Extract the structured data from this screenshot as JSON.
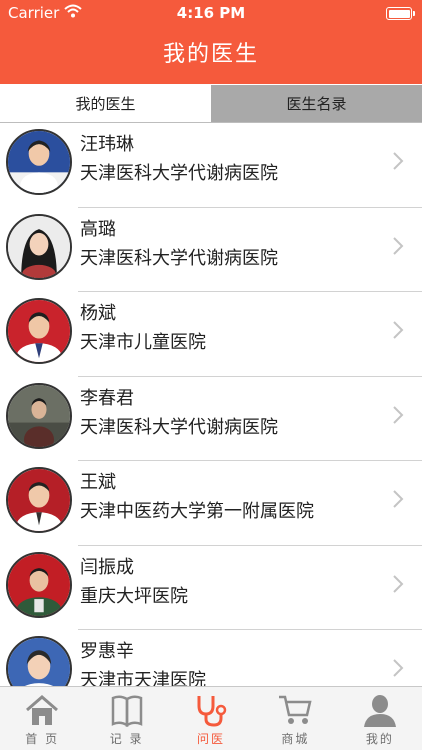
{
  "status_bar": {
    "carrier": "Carrier",
    "time": "4:16 PM",
    "wifi_icon": "wifi-icon",
    "battery_icon": "battery-icon"
  },
  "nav": {
    "title": "我的医生"
  },
  "segments": [
    {
      "label": "我的医生",
      "selected": true
    },
    {
      "label": "医生名录",
      "selected": false
    }
  ],
  "doctors": [
    {
      "name": "汪玮琳",
      "hospital": "天津医科大学代谢病医院"
    },
    {
      "name": "高璐",
      "hospital": "天津医科大学代谢病医院"
    },
    {
      "name": "杨斌",
      "hospital": "天津市儿童医院"
    },
    {
      "name": "李春君",
      "hospital": "天津医科大学代谢病医院"
    },
    {
      "name": "王斌",
      "hospital": "天津中医药大学第一附属医院"
    },
    {
      "name": "闫振成",
      "hospital": "重庆大坪医院"
    },
    {
      "name": "罗惠辛",
      "hospital": "天津市天津医院"
    }
  ],
  "tabbar": [
    {
      "label": "首 页",
      "icon": "home-icon",
      "active": false
    },
    {
      "label": "记 录",
      "icon": "book-icon",
      "active": false
    },
    {
      "label": "问医",
      "icon": "stethoscope-icon",
      "active": true
    },
    {
      "label": "商城",
      "icon": "cart-icon",
      "active": false
    },
    {
      "label": "我的",
      "icon": "person-icon",
      "active": false
    }
  ],
  "colors": {
    "brand": "#f55a3c",
    "inactive_tab": "#a9a9a9",
    "tab_icon": "#8c8c8c"
  }
}
